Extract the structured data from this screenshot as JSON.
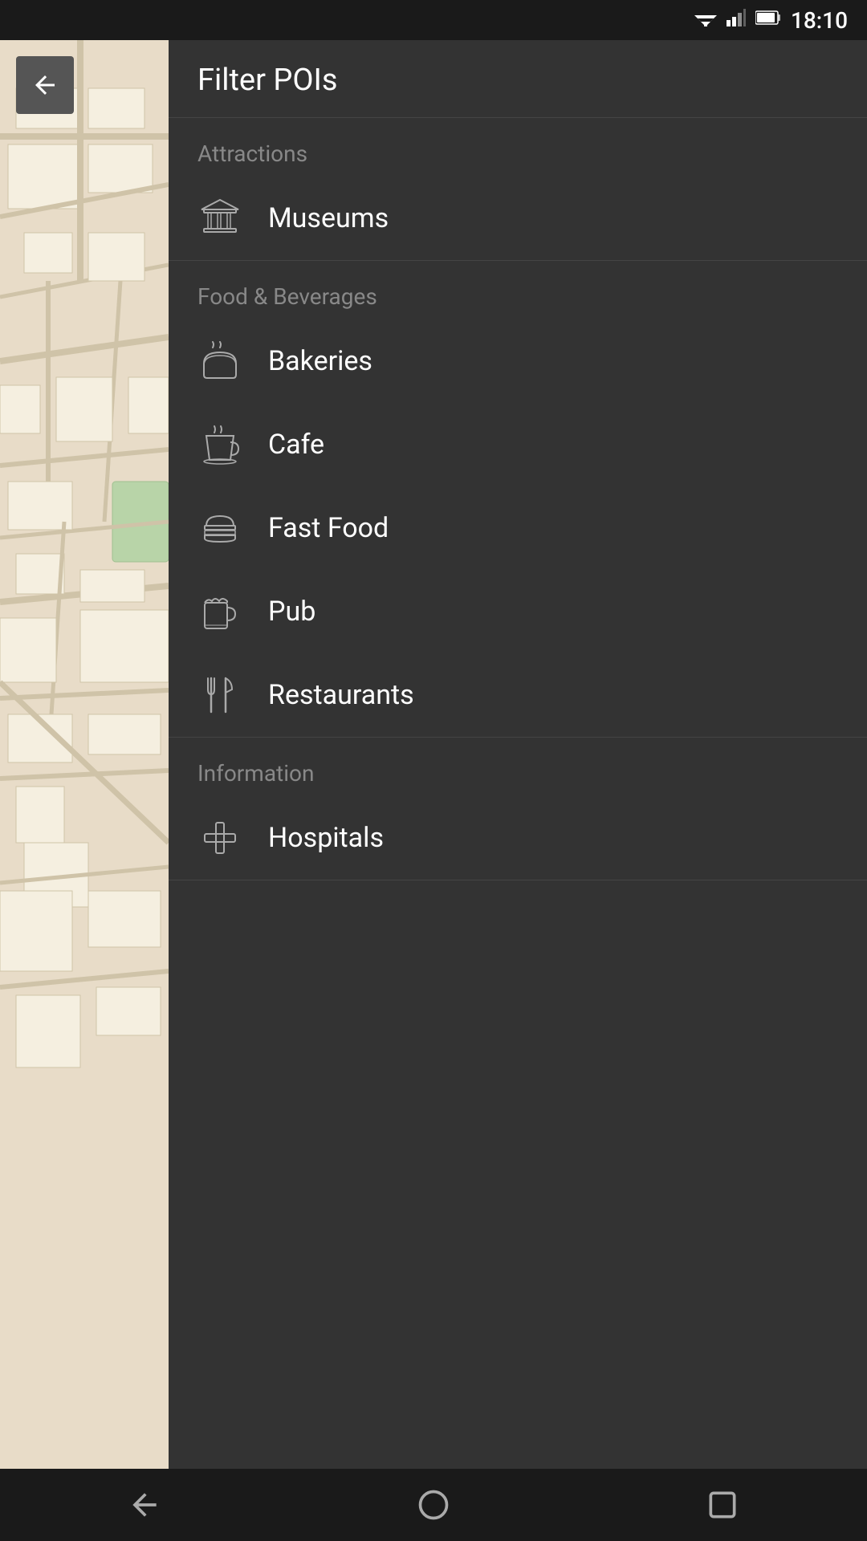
{
  "statusBar": {
    "time": "18:10"
  },
  "header": {
    "title": "Filter POIs"
  },
  "sections": [
    {
      "id": "attractions",
      "label": "Attractions",
      "items": [
        {
          "id": "museums",
          "label": "Museums",
          "icon": "museum"
        }
      ]
    },
    {
      "id": "food-beverages",
      "label": "Food & Beverages",
      "items": [
        {
          "id": "bakeries",
          "label": "Bakeries",
          "icon": "bakery"
        },
        {
          "id": "cafe",
          "label": "Cafe",
          "icon": "cafe"
        },
        {
          "id": "fast-food",
          "label": "Fast Food",
          "icon": "fast-food"
        },
        {
          "id": "pub",
          "label": "Pub",
          "icon": "pub"
        },
        {
          "id": "restaurants",
          "label": "Restaurants",
          "icon": "restaurant"
        }
      ]
    },
    {
      "id": "information",
      "label": "Information",
      "items": [
        {
          "id": "hospitals",
          "label": "Hospitals",
          "icon": "hospital"
        }
      ]
    }
  ],
  "navBar": {
    "back": "back-icon",
    "home": "home-circle-icon",
    "recent": "recent-apps-icon"
  }
}
